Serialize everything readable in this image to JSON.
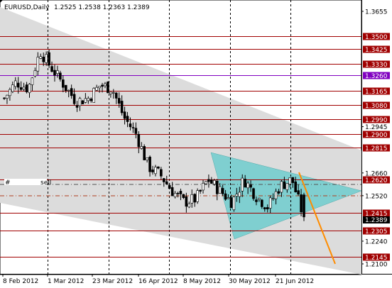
{
  "header": {
    "symbol_timeframe": "EURUSD,Daily",
    "ohlc": "1.2525 1.2538 1.2363 1.2389"
  },
  "price_axis": {
    "plain_ticks": [
      "1.3655",
      "1.2945",
      "1.2660",
      "1.2520",
      "1.2240",
      "1.2100"
    ],
    "current_price": "1.2389"
  },
  "time_axis": {
    "labels": [
      "8 Feb 2012",
      "1 Mar 2012",
      "23 Mar 2012",
      "16 Apr 2012",
      "8 May 2012",
      "30 May 2012",
      "21 Jun 2012"
    ]
  },
  "levels": [
    {
      "price": "1.3500",
      "color": "#a00000"
    },
    {
      "price": "1.3425",
      "color": "#a00000"
    },
    {
      "price": "1.3330",
      "color": "#a00000"
    },
    {
      "price": "1.3260",
      "color": "#8000c0"
    },
    {
      "price": "1.3165",
      "color": "#a00000"
    },
    {
      "price": "1.3080",
      "color": "#a00000"
    },
    {
      "price": "1.2990",
      "color": "#a00000"
    },
    {
      "price": "1.2900",
      "color": "#a00000"
    },
    {
      "price": "1.2815",
      "color": "#a00000"
    },
    {
      "price": "1.2620",
      "color": "#a00000"
    },
    {
      "price": "1.2415",
      "color": "#a00000"
    },
    {
      "price": "1.2305",
      "color": "#a00000"
    },
    {
      "price": "1.2145",
      "color": "#a00000"
    }
  ],
  "order_label": {
    "ticket": "#",
    "type": "sell"
  },
  "colors": {
    "background": "#ffffff",
    "channel_fill": "#dcdcdc",
    "triangle_fill": "#7fcfd0",
    "candle": "#000000",
    "projection_line": "#ff8c00",
    "current_price_badge": "#000000",
    "grid": "#000000"
  },
  "chart_data": {
    "type": "candlestick",
    "symbol": "EURUSD",
    "timeframe": "Daily",
    "last_bar": {
      "open": 1.2525,
      "high": 1.2538,
      "low": 1.2363,
      "close": 1.2389
    },
    "ylim": [
      1.205,
      1.368
    ],
    "grid": true,
    "dates": [
      "8 Feb 2012",
      "1 Mar 2012",
      "23 Mar 2012",
      "16 Apr 2012",
      "8 May 2012",
      "30 May 2012",
      "21 Jun 2012"
    ],
    "anchor_closes": [
      1.312,
      1.322,
      1.318,
      1.341,
      1.33,
      1.32,
      1.31,
      1.312,
      1.32,
      1.318,
      1.3,
      1.29,
      1.27,
      1.265,
      1.255,
      1.248,
      1.25,
      1.262,
      1.255,
      1.248,
      1.262,
      1.252,
      1.245,
      1.258,
      1.262,
      1.238
    ],
    "horizontal_levels": [
      1.35,
      1.3425,
      1.333,
      1.326,
      1.3165,
      1.308,
      1.299,
      1.29,
      1.2815,
      1.262,
      1.2415,
      1.2305,
      1.2145
    ],
    "dashed_levels": [
      1.26,
      1.2555
    ],
    "solid_level": 1.2415
  }
}
